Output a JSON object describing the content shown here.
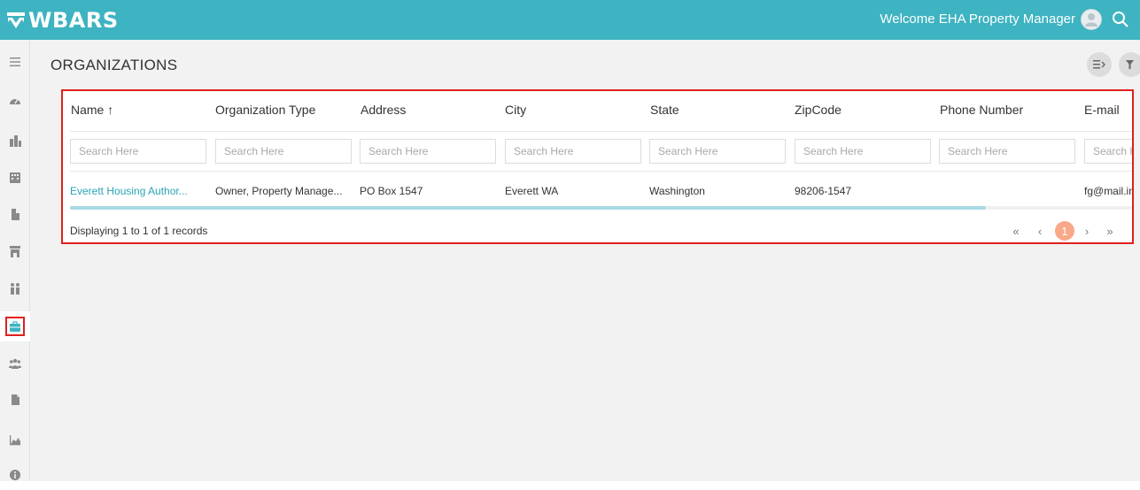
{
  "app": {
    "name": "WBARS",
    "welcome": "Welcome EHA Property Manager"
  },
  "icons": {
    "logo": "logo-mark-icon",
    "avatar": "user-avatar-icon",
    "search": "search-icon",
    "columns": "columns-toggle-icon",
    "filter": "filter-icon"
  },
  "sidebar": {
    "items": [
      {
        "icon": "menu-icon"
      },
      {
        "icon": "dashboard-icon"
      },
      {
        "icon": "buildings-icon"
      },
      {
        "icon": "properties-icon"
      },
      {
        "icon": "building-icon"
      },
      {
        "icon": "storefront-icon"
      },
      {
        "icon": "people-group-icon"
      },
      {
        "icon": "briefcase-icon",
        "active": true
      },
      {
        "icon": "users-icon"
      },
      {
        "icon": "document-icon"
      },
      {
        "icon": "chart-icon"
      },
      {
        "icon": "info-icon"
      }
    ]
  },
  "page": {
    "title": "ORGANIZATIONS"
  },
  "table": {
    "columns": [
      "Name ↑",
      "Organization Type",
      "Address",
      "City",
      "State",
      "ZipCode",
      "Phone Number",
      "E-mail"
    ],
    "search_placeholder": "Search Here",
    "rows": [
      [
        "Everett Housing Author...",
        "Owner, Property Manage...",
        "PO Box 1547",
        "Everett WA",
        "Washington",
        "98206-1547",
        "",
        "fg@mail.in"
      ]
    ],
    "footer": "Displaying 1 to 1 of 1 records"
  },
  "pager": {
    "first": "«",
    "prev": "‹",
    "current": "1",
    "next": "›",
    "last": "»"
  },
  "colors": {
    "brand": "#3eb3c1",
    "highlight": "#e0201c",
    "link": "#2aa5b5",
    "page_active": "#f9a98a"
  }
}
